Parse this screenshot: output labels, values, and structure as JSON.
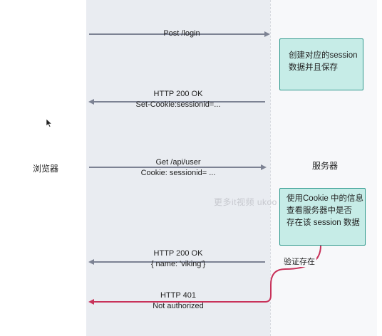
{
  "actors": {
    "browser": "浏览器",
    "server": "服务器"
  },
  "messages": [
    {
      "line1": "Post /login",
      "line2": ""
    },
    {
      "line1": "HTTP 200 OK",
      "line2": "Set-Cookie:sessionid=..."
    },
    {
      "line1": "Get /api/user",
      "line2": "Cookie: sessionid= ..."
    },
    {
      "line1": "HTTP 200 OK",
      "line2": "{ name: 'viking'}"
    },
    {
      "line1": "HTTP 401",
      "line2": "Not authorized"
    }
  ],
  "notes": {
    "create_session": {
      "line1": "创建对应的session",
      "line2": "数据并且保存"
    },
    "use_cookie": {
      "line1": "使用Cookie 中的信息",
      "line2": "查看服务器中是否",
      "line3": "存在该 session 数据"
    }
  },
  "verify_label": "验证存在",
  "watermark": "更多it视频 ukoo",
  "colors": {
    "arrow_gray": "#7c8293",
    "arrow_red": "#c8325a",
    "note_fill": "#c6ece7",
    "note_border": "#2f9a8d"
  }
}
